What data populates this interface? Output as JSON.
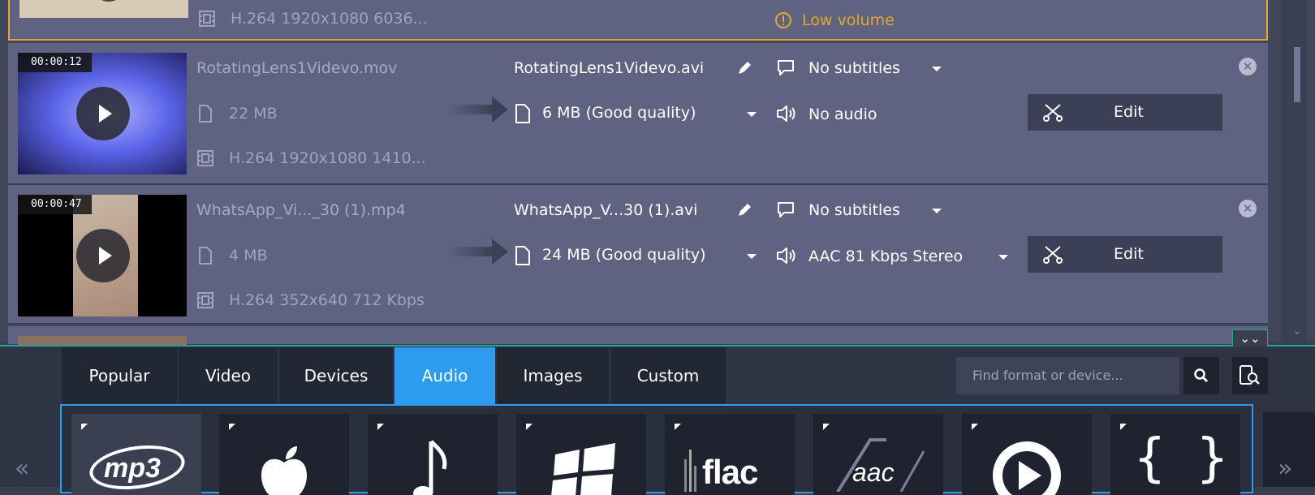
{
  "rows": [
    {
      "video_codec": "H.264 1920x1080 6036...",
      "warning": "Low volume"
    },
    {
      "timecode": "00:00:12",
      "input_name": "RotatingLens1Videvo.mov",
      "input_size": "22 MB",
      "video_codec": "H.264 1920x1080 1410...",
      "output_name": "RotatingLens1Videvo.avi",
      "output_size": "6 MB (Good quality)",
      "subtitles": "No subtitles",
      "audio": "No audio",
      "edit_label": "Edit"
    },
    {
      "timecode": "00:00:47",
      "input_name": "WhatsApp_Vi..._30 (1).mp4",
      "input_size": "4 MB",
      "video_codec": "H.264 352x640 712 Kbps",
      "output_name": "WhatsApp_V...30 (1).avi",
      "output_size": "24 MB (Good quality)",
      "subtitles": "No subtitles",
      "audio": "AAC 81 Kbps Stereo",
      "edit_label": "Edit"
    }
  ],
  "tabs": [
    "Popular",
    "Video",
    "Devices",
    "Audio",
    "Images",
    "Custom"
  ],
  "active_tab": "Audio",
  "search": {
    "placeholder": "Find format or device..."
  },
  "formats": [
    {
      "icon": "mp3-icon",
      "label": "mp3"
    },
    {
      "icon": "apple-icon",
      "label": ""
    },
    {
      "icon": "music-note-icon",
      "label": ""
    },
    {
      "icon": "windows-icon",
      "label": ""
    },
    {
      "icon": "flac-icon",
      "label": "flac"
    },
    {
      "icon": "aac-icon",
      "label": "aac"
    },
    {
      "icon": "play-circle-icon",
      "label": ""
    },
    {
      "icon": "braces-icon",
      "label": "{ }"
    }
  ],
  "nav": {
    "prev": "«",
    "next": "»"
  },
  "colors": {
    "accent": "#2d9cf0",
    "warning": "#e4a72e",
    "divider": "#20a895"
  }
}
